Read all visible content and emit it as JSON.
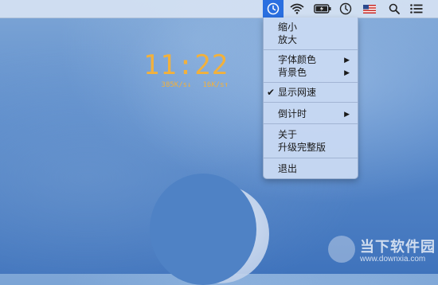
{
  "menubar": {
    "icons": [
      "clock-app-icon",
      "wifi-icon",
      "battery-icon",
      "clock-icon",
      "us-flag-icon",
      "search-icon",
      "list-icon"
    ]
  },
  "widget": {
    "time": "11:22",
    "download": "385K/s↓",
    "upload": "16K/s↑",
    "color": "#f2b13c"
  },
  "menu": {
    "zoom_out": "缩小",
    "zoom_in": "放大",
    "font_color": "字体颜色",
    "background_color": "背景色",
    "show_speed": "显示网速",
    "show_speed_checked": true,
    "countdown": "倒计时",
    "about": "关于",
    "upgrade": "升级完整版",
    "quit": "退出"
  },
  "watermark": {
    "title": "当下软件园",
    "url": "www.downxia.com"
  },
  "colors": {
    "active_menubar": "#2a6fe0",
    "wallpaper": "#5c8ccb"
  }
}
